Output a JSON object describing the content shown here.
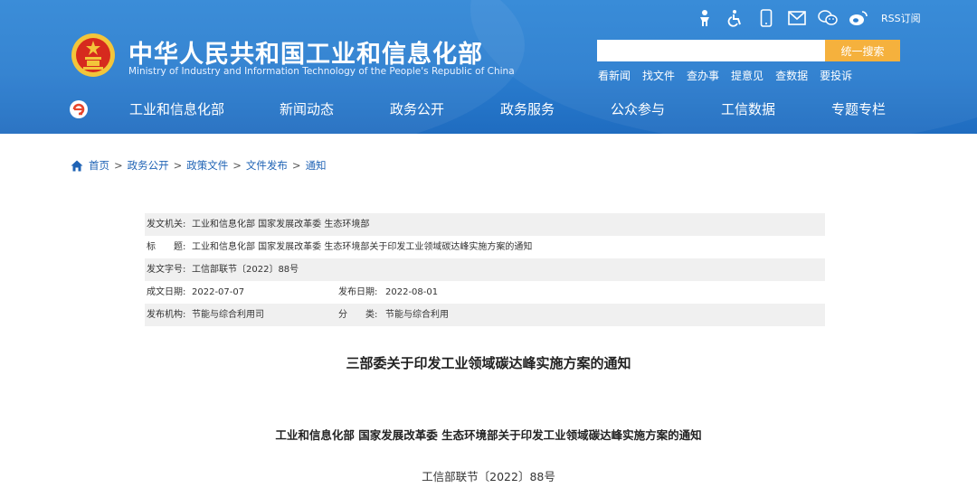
{
  "header": {
    "title": "中华人民共和国工业和信息化部",
    "subtitle": "Ministry of Industry and Information Technology of the People's Republic of China",
    "icons": [
      "elder-mode-icon",
      "accessibility-icon",
      "mobile-icon",
      "mail-icon",
      "wechat-icon",
      "weibo-icon",
      "rss-icon"
    ],
    "rss_label": "RSS订阅",
    "search": {
      "placeholder": "",
      "button_label": "统一搜索"
    },
    "quick_links": [
      "看新闻",
      "找文件",
      "查办事",
      "提意见",
      "查数据",
      "要投诉"
    ]
  },
  "nav": {
    "items": [
      "工业和信息化部",
      "新闻动态",
      "政务公开",
      "政务服务",
      "公众参与",
      "工信数据",
      "专题专栏"
    ]
  },
  "breadcrumb": [
    "首页",
    "政务公开",
    "政策文件",
    "文件发布",
    "通知"
  ],
  "meta": {
    "issuer_label": "发文机关:",
    "issuer": "工业和信息化部 国家发展改革委 生态环境部",
    "title_label": "标　　题:",
    "title": "工业和信息化部 国家发展改革委 生态环境部关于印发工业领域碳达峰实施方案的通知",
    "doc_no_label": "发文字号:",
    "doc_no": "工信部联节〔2022〕88号",
    "created_label": "成文日期:",
    "created": "2022-07-07",
    "published_label": "发布日期:",
    "published": "2022-08-01",
    "org_label": "发布机构:",
    "org": "节能与综合利用司",
    "category_label": "分　　类:",
    "category": "节能与综合利用"
  },
  "document": {
    "title": "三部委关于印发工业领域碳达峰实施方案的通知",
    "subtitle": "工业和信息化部 国家发展改革委 生态环境部关于印发工业领域碳达峰实施方案的通知",
    "number": "工信部联节〔2022〕88号"
  },
  "colors": {
    "header_blue": "#2a7dcf",
    "search_button": "#f5b13d",
    "link_blue": "#1f63b5",
    "emblem_red": "#d62a1e",
    "emblem_gold": "#f3c53a"
  }
}
